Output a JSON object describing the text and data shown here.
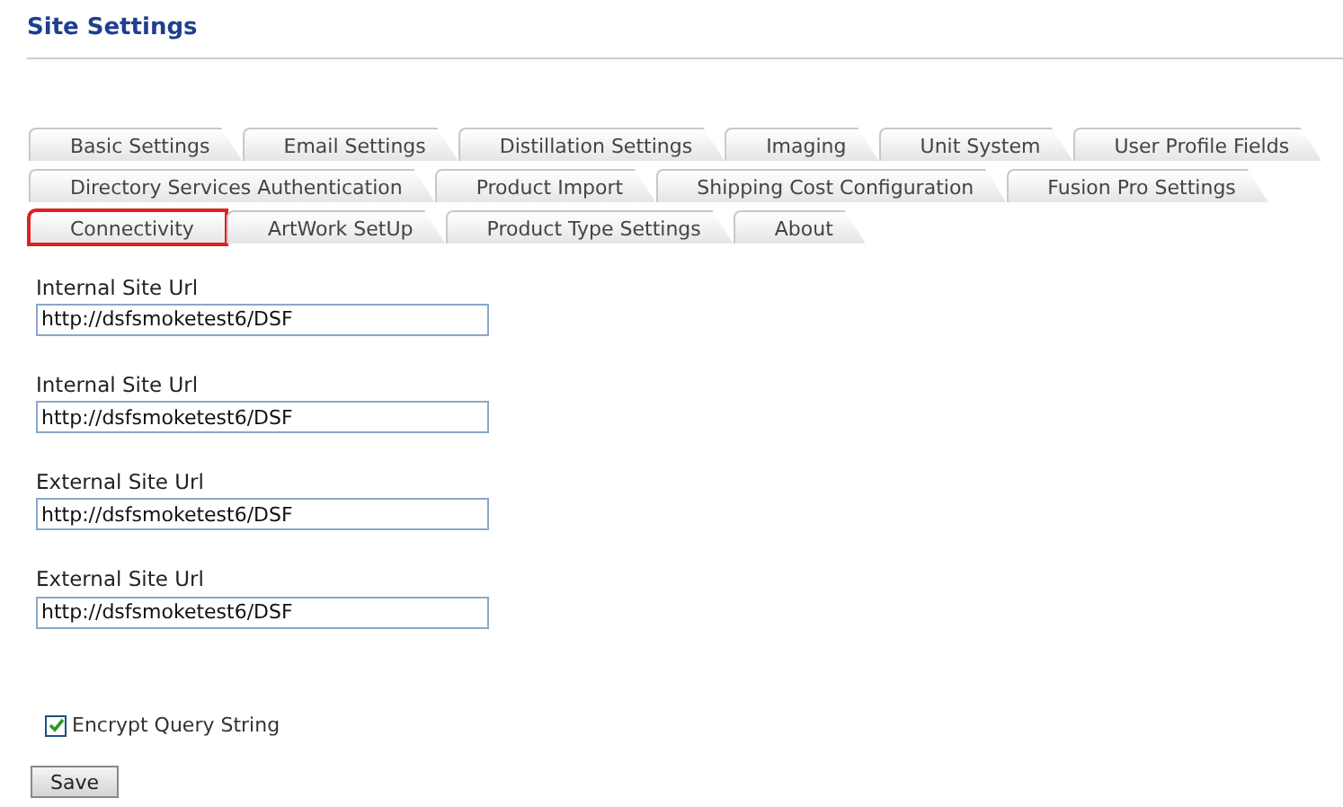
{
  "page": {
    "title": "Site Settings"
  },
  "tab_rows": [
    [
      {
        "label": "Basic Settings",
        "selected": false
      },
      {
        "label": "Email Settings",
        "selected": false
      },
      {
        "label": "Distillation Settings",
        "selected": false
      },
      {
        "label": "Imaging",
        "selected": false
      },
      {
        "label": "Unit System",
        "selected": false
      },
      {
        "label": "User Profile Fields",
        "selected": false
      }
    ],
    [
      {
        "label": "Directory Services Authentication",
        "selected": false
      },
      {
        "label": "Product Import",
        "selected": false
      },
      {
        "label": "Shipping Cost Configuration",
        "selected": false
      },
      {
        "label": "Fusion Pro Settings",
        "selected": false
      }
    ],
    [
      {
        "label": "Connectivity",
        "selected": true
      },
      {
        "label": "ArtWork SetUp",
        "selected": false
      },
      {
        "label": "Product Type Settings",
        "selected": false
      },
      {
        "label": "About",
        "selected": false
      }
    ]
  ],
  "fields": [
    {
      "label": "Internal Site Url",
      "value": "http://dsfsmoketest6/DSF"
    },
    {
      "label": "Internal Site Url",
      "value": "http://dsfsmoketest6/DSF"
    },
    {
      "label": "External Site Url",
      "value": "http://dsfsmoketest6/DSF"
    },
    {
      "label": "External Site Url",
      "value": "http://dsfsmoketest6/DSF"
    }
  ],
  "encrypt_query_string": {
    "label": "Encrypt Query String",
    "checked": true
  },
  "save_button": "Save"
}
